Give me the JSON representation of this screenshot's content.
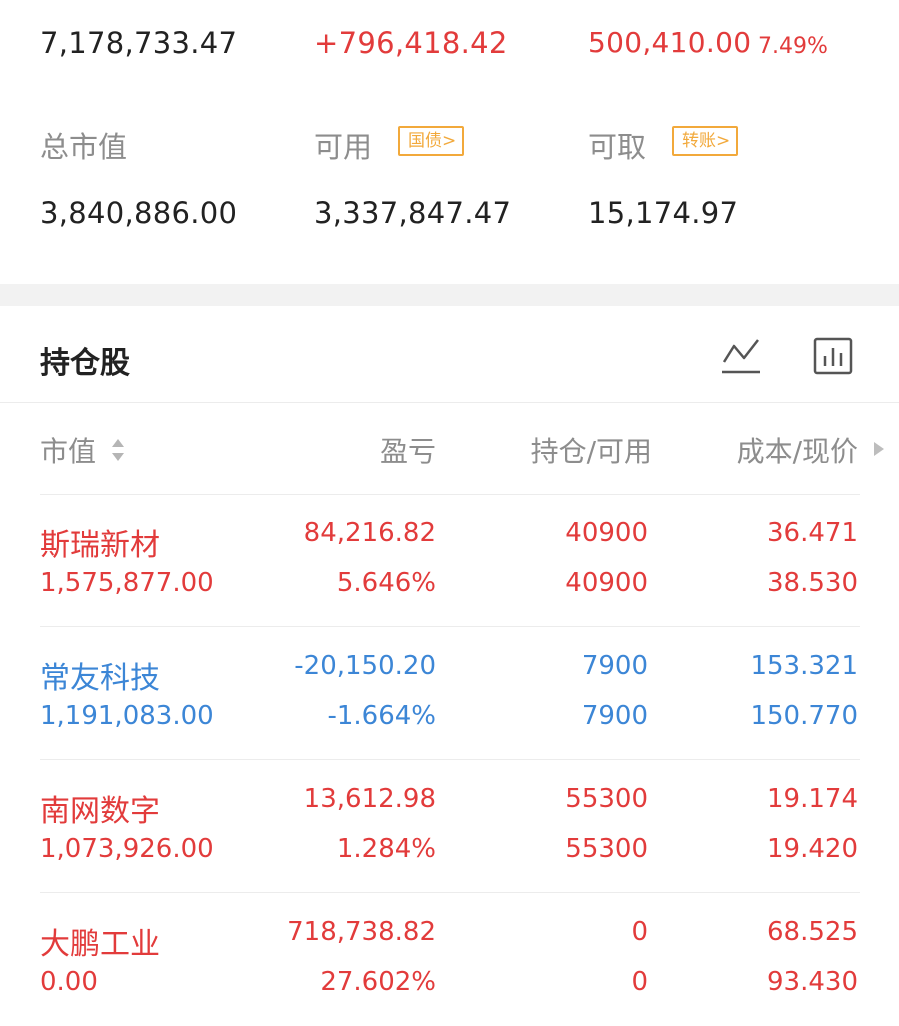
{
  "summary": {
    "total_assets": "7,178,733.47",
    "profit": "+796,418.42",
    "daily_value": "500,410.00",
    "daily_pct": "7.49%",
    "market_value_label": "总市值",
    "market_value": "3,840,886.00",
    "available_label": "可用",
    "bond_tag": "国债>",
    "available": "3,337,847.47",
    "withdrawable_label": "可取",
    "transfer_tag": "转账>",
    "withdrawable": "15,174.97"
  },
  "holdings": {
    "title": "持仓股",
    "headers": {
      "market_value": "市值",
      "pnl": "盈亏",
      "position": "持仓/可用",
      "cost_price": "成本/现价"
    },
    "rows": [
      {
        "name": "斯瑞新材",
        "value": "1,575,877.00",
        "pnl": "84,216.82",
        "pnl_pct": "5.646%",
        "hold": "40900",
        "avail": "40900",
        "cost": "36.471",
        "price": "38.530",
        "color": "#e23b3b"
      },
      {
        "name": "常友科技",
        "value": "1,191,083.00",
        "pnl": "-20,150.20",
        "pnl_pct": "-1.664%",
        "hold": "7900",
        "avail": "7900",
        "cost": "153.321",
        "price": "150.770",
        "color": "#3c86d6"
      },
      {
        "name": "南网数字",
        "value": "1,073,926.00",
        "pnl": "13,612.98",
        "pnl_pct": "1.284%",
        "hold": "55300",
        "avail": "55300",
        "cost": "19.174",
        "price": "19.420",
        "color": "#e23b3b"
      },
      {
        "name": "大鹏工业",
        "value": "0.00",
        "pnl": "718,738.82",
        "pnl_pct": "27.602%",
        "hold": "0",
        "avail": "0",
        "cost": "68.525",
        "price": "93.430",
        "color": "#e23b3b"
      }
    ]
  },
  "icons": {
    "trend": "line-chart-icon",
    "bars": "bar-chart-icon",
    "sort": "sort-icon",
    "more": "triangle-right-icon"
  }
}
